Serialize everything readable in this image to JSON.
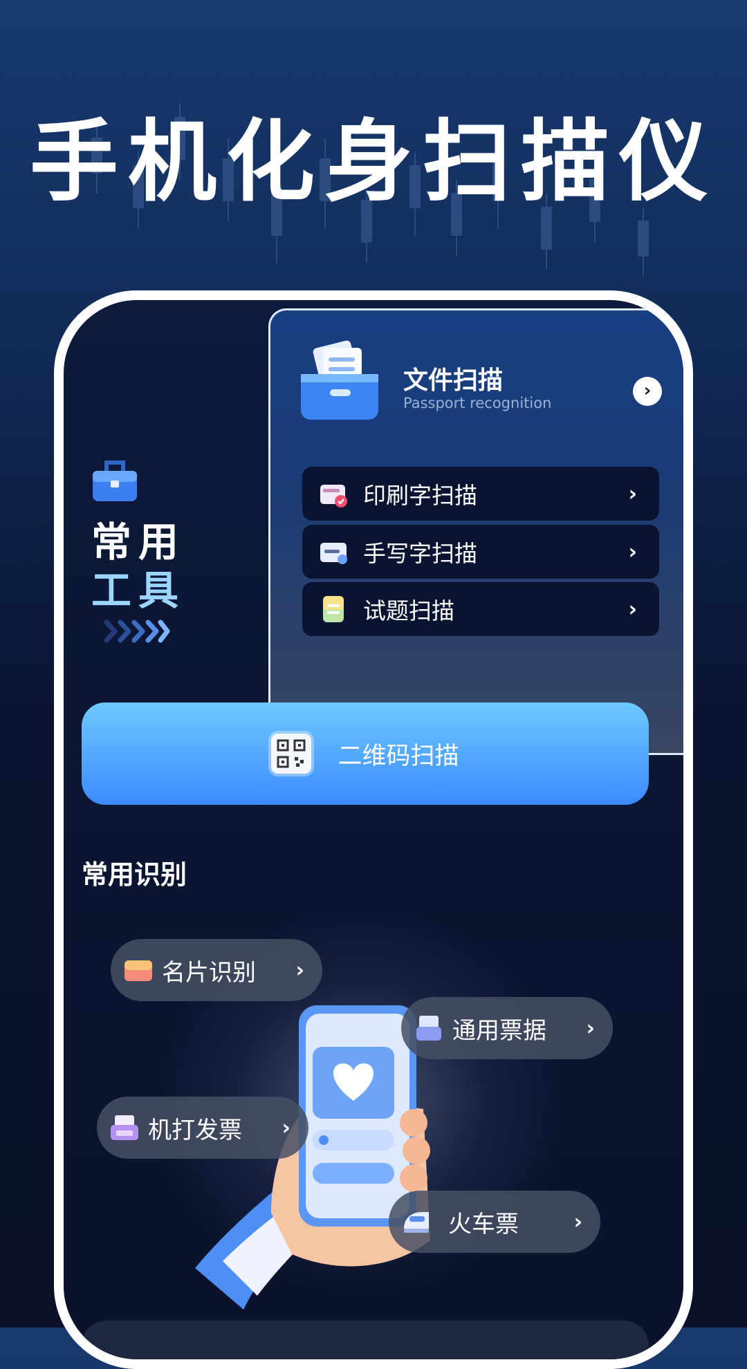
{
  "headline": "手机化身扫描仪",
  "tools": {
    "title_line1": "常用",
    "title_line2": "工具"
  },
  "document_scan": {
    "title": "文件扫描",
    "subtitle": "Passport recognition",
    "go_icon": "chevron-right-icon",
    "items": [
      {
        "label": "印刷字扫描",
        "icon": "print-text-icon"
      },
      {
        "label": "手写字扫描",
        "icon": "handwriting-icon"
      },
      {
        "label": "试题扫描",
        "icon": "exam-paper-icon"
      }
    ]
  },
  "qr_scan": {
    "label": "二维码扫描",
    "icon": "qr-code-icon"
  },
  "recognition": {
    "section_title": "常用识别",
    "items": [
      {
        "label": "名片识别",
        "icon": "business-card-icon"
      },
      {
        "label": "通用票据",
        "icon": "receipt-icon"
      },
      {
        "label": "机打发票",
        "icon": "invoice-printer-icon"
      },
      {
        "label": "火车票",
        "icon": "train-icon"
      }
    ]
  },
  "colors": {
    "accent_blue": "#3c8bff",
    "accent_light": "#6cc9ff",
    "background_dark": "#0a1128"
  }
}
